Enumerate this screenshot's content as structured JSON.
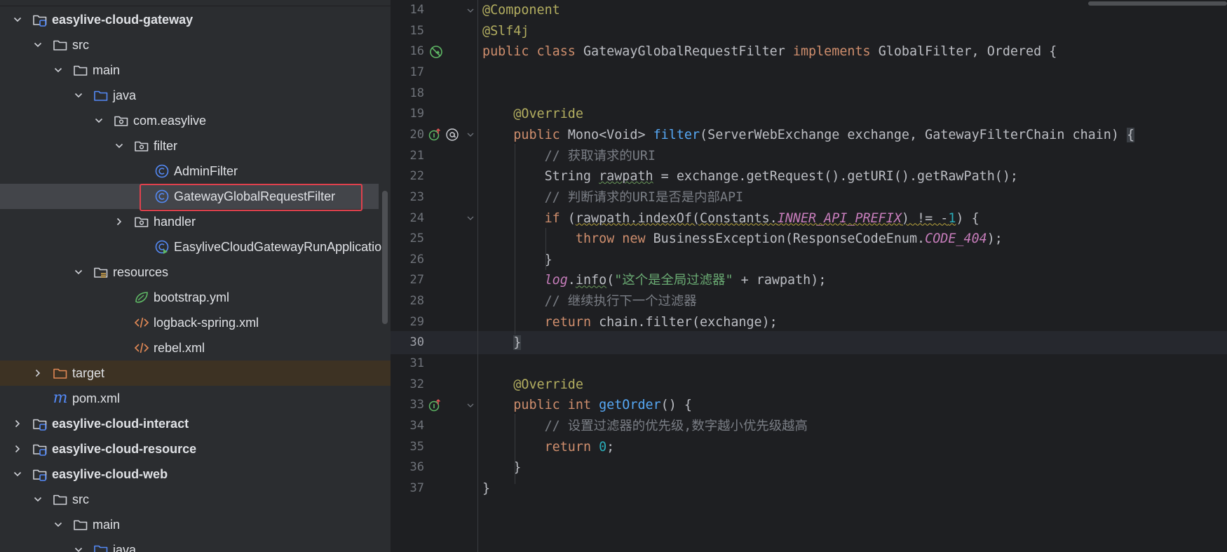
{
  "tree": {
    "items": [
      {
        "label": "easylive-cloud-gateway",
        "depth": 0,
        "chevron": "down",
        "icon": "module-folder-icon",
        "bold": true
      },
      {
        "label": "src",
        "depth": 1,
        "chevron": "down",
        "icon": "folder-icon"
      },
      {
        "label": "main",
        "depth": 2,
        "chevron": "down",
        "icon": "folder-icon"
      },
      {
        "label": "java",
        "depth": 3,
        "chevron": "down",
        "icon": "source-folder-icon"
      },
      {
        "label": "com.easylive",
        "depth": 4,
        "chevron": "down",
        "icon": "package-icon"
      },
      {
        "label": "filter",
        "depth": 5,
        "chevron": "down",
        "icon": "package-icon"
      },
      {
        "label": "AdminFilter",
        "depth": 6,
        "chevron": "none",
        "icon": "class-icon"
      },
      {
        "label": "GatewayGlobalRequestFilter",
        "depth": 6,
        "chevron": "none",
        "icon": "class-icon",
        "selected": true
      },
      {
        "label": "handler",
        "depth": 5,
        "chevron": "right",
        "icon": "package-icon"
      },
      {
        "label": "EasyliveCloudGatewayRunApplication",
        "depth": 6,
        "chevron": "none",
        "icon": "spring-class-icon"
      },
      {
        "label": "resources",
        "depth": 3,
        "chevron": "down",
        "icon": "resources-folder-icon"
      },
      {
        "label": "bootstrap.yml",
        "depth": 5,
        "chevron": "none",
        "icon": "yaml-icon"
      },
      {
        "label": "logback-spring.xml",
        "depth": 5,
        "chevron": "none",
        "icon": "xml-icon"
      },
      {
        "label": "rebel.xml",
        "depth": 5,
        "chevron": "none",
        "icon": "xml-icon"
      },
      {
        "label": "target",
        "depth": 1,
        "chevron": "right",
        "icon": "excluded-folder-icon",
        "excluded": true
      },
      {
        "label": "pom.xml",
        "depth": 1,
        "chevron": "none",
        "icon": "maven-icon"
      },
      {
        "label": "easylive-cloud-interact",
        "depth": 0,
        "chevron": "right",
        "icon": "module-folder-icon",
        "bold": true
      },
      {
        "label": "easylive-cloud-resource",
        "depth": 0,
        "chevron": "right",
        "icon": "module-folder-icon",
        "bold": true
      },
      {
        "label": "easylive-cloud-web",
        "depth": 0,
        "chevron": "down",
        "icon": "module-folder-icon",
        "bold": true
      },
      {
        "label": "src",
        "depth": 1,
        "chevron": "down",
        "icon": "folder-icon"
      },
      {
        "label": "main",
        "depth": 2,
        "chevron": "down",
        "icon": "folder-icon"
      },
      {
        "label": "java",
        "depth": 3,
        "chevron": "down",
        "icon": "source-folder-icon"
      }
    ]
  },
  "editor": {
    "lines": [
      {
        "n": "14",
        "html": "<span class='ann'>@Component</span>",
        "fold": "down"
      },
      {
        "n": "15",
        "html": "<span class='ann'>@Slf4j</span>"
      },
      {
        "n": "16",
        "html": "<span class='kw'>public class </span>GatewayGlobalRequestFilter <span class='kw'>implements </span>GlobalFilter, Ordered {",
        "gutter": "no-bean"
      },
      {
        "n": "17",
        "html": ""
      },
      {
        "n": "18",
        "html": ""
      },
      {
        "n": "19",
        "html": "    <span class='ann'>@Override</span>"
      },
      {
        "n": "20",
        "html": "    <span class='kw'>public </span>Mono&lt;Void&gt; <span class='fn'>filter</span>(ServerWebExchange exchange, GatewayFilterChain chain) <span class='brace-hl'>{</span>",
        "gutter": "override-at",
        "fold": "down"
      },
      {
        "n": "21",
        "html": "        <span class='cmt'>// 获取请求的URI</span>"
      },
      {
        "n": "22",
        "html": "        String <span class='wavyg'>rawpath</span> = exchange.getRequest().getURI().getRawPath();"
      },
      {
        "n": "23",
        "html": "        <span class='cmt'>// 判断请求的URI是否是内部API</span>"
      },
      {
        "n": "24",
        "html": "        <span class='kw'>if </span>(<span class='wavy'>rawpath.indexOf(Constants.<span class='cst'>INNER_API_PREFIX</span>) != -<span class='num'>1</span></span>) {",
        "fold": "down"
      },
      {
        "n": "25",
        "html": "            <span class='kw'>throw new </span>BusinessException(ResponseCodeEnum.<span class='cst'>CODE_404</span>);"
      },
      {
        "n": "26",
        "html": "        }"
      },
      {
        "n": "27",
        "html": "        <span class='fld'>log</span>.<span class='wavyg'>info</span>(<span class='str'>\"这个是全局过滤器\"</span> + rawpath);"
      },
      {
        "n": "28",
        "html": "        <span class='cmt'>// 继续执行下一个过滤器</span>"
      },
      {
        "n": "29",
        "html": "        <span class='kw'>return </span>chain.filter(exchange);"
      },
      {
        "n": "30",
        "html": "    <span class='brace-hl'>}</span>",
        "current": true
      },
      {
        "n": "31",
        "html": ""
      },
      {
        "n": "32",
        "html": "    <span class='ann'>@Override</span>"
      },
      {
        "n": "33",
        "html": "    <span class='kw'>public int </span><span class='fn'>getOrder</span>() {",
        "gutter": "override",
        "fold": "down"
      },
      {
        "n": "34",
        "html": "        <span class='cmt'>// 设置过滤器的优先级,数字越小优先级越高</span>"
      },
      {
        "n": "35",
        "html": "        <span class='kw'>return </span><span class='num'>0</span>;"
      },
      {
        "n": "36",
        "html": "    }"
      },
      {
        "n": "37",
        "html": "}"
      }
    ]
  },
  "colors": {
    "tree_bg": "#2b2d30",
    "editor_bg": "#1e1f22",
    "selection_border": "#e0414d",
    "keyword": "#cf8e6d",
    "annotation": "#b3ae60",
    "method": "#56a8f5",
    "comment": "#7a7e85",
    "string": "#6aab73",
    "constant": "#c77dbb"
  }
}
